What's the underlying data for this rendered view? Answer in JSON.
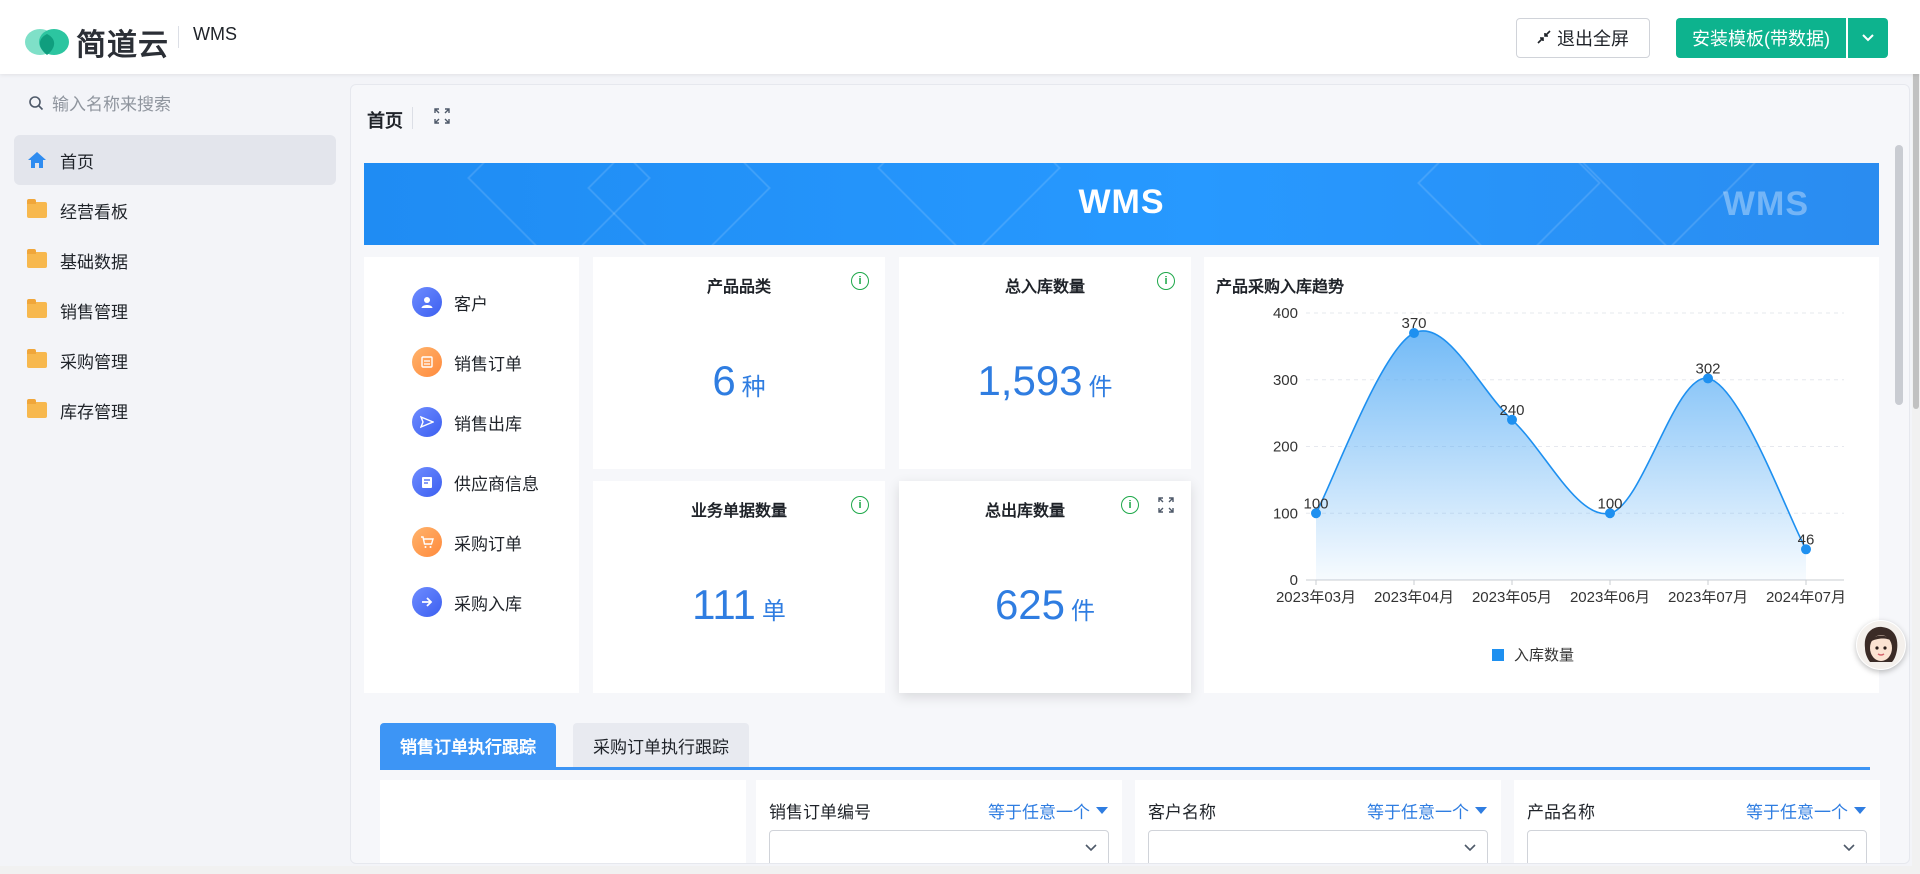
{
  "header": {
    "logo_text": "简道云",
    "app_name": "WMS",
    "exit_fullscreen_label": "退出全屏",
    "install_template_label": "安装模板(带数据)"
  },
  "sidebar": {
    "search_placeholder": "输入名称来搜索",
    "items": [
      {
        "label": "首页",
        "icon": "home-icon"
      },
      {
        "label": "经营看板",
        "icon": "folder-icon"
      },
      {
        "label": "基础数据",
        "icon": "folder-icon"
      },
      {
        "label": "销售管理",
        "icon": "folder-icon"
      },
      {
        "label": "采购管理",
        "icon": "folder-icon"
      },
      {
        "label": "库存管理",
        "icon": "folder-icon"
      }
    ]
  },
  "main": {
    "tab_label": "首页",
    "banner_title": "WMS",
    "banner_logo": "WMS",
    "shortcuts": [
      {
        "label": "客户",
        "icon": "customer-icon"
      },
      {
        "label": "销售订单",
        "icon": "sales-order-icon"
      },
      {
        "label": "销售出库",
        "icon": "send-icon"
      },
      {
        "label": "供应商信息",
        "icon": "supplier-icon"
      },
      {
        "label": "采购订单",
        "icon": "cart-icon"
      },
      {
        "label": "采购入库",
        "icon": "arrow-in-icon"
      }
    ],
    "stats": [
      {
        "title": "产品品类",
        "value": "6",
        "unit": "种"
      },
      {
        "title": "总入库数量",
        "value": "1,593",
        "unit": "件"
      },
      {
        "title": "业务单据数量",
        "value": "111",
        "unit": "单"
      },
      {
        "title": "总出库数量",
        "value": "625",
        "unit": "件"
      }
    ],
    "chart_title": "产品采购入库趋势",
    "sub_tabs": [
      "销售订单执行跟踪",
      "采购订单执行跟踪"
    ],
    "filters": [
      {
        "label": "销售订单编号",
        "op": "等于任意一个"
      },
      {
        "label": "客户名称",
        "op": "等于任意一个"
      },
      {
        "label": "产品名称",
        "op": "等于任意一个"
      }
    ]
  },
  "colors": {
    "accent": "#0db38e",
    "primary_blue": "#2f7de1",
    "banner_blue": "#2799ff",
    "series_blue": "#1e90f0"
  },
  "chart_data": {
    "type": "area",
    "title": "产品采购入库趋势",
    "categories": [
      "2023年03月",
      "2023年04月",
      "2023年05月",
      "2023年06月",
      "2023年07月",
      "2024年07月"
    ],
    "series": [
      {
        "name": "入库数量",
        "values": [
          100,
          370,
          240,
          100,
          302,
          46
        ]
      }
    ],
    "ylim": [
      0,
      400
    ],
    "yticks": [
      0,
      100,
      200,
      300,
      400
    ],
    "grid": true,
    "legend": "bottom"
  }
}
